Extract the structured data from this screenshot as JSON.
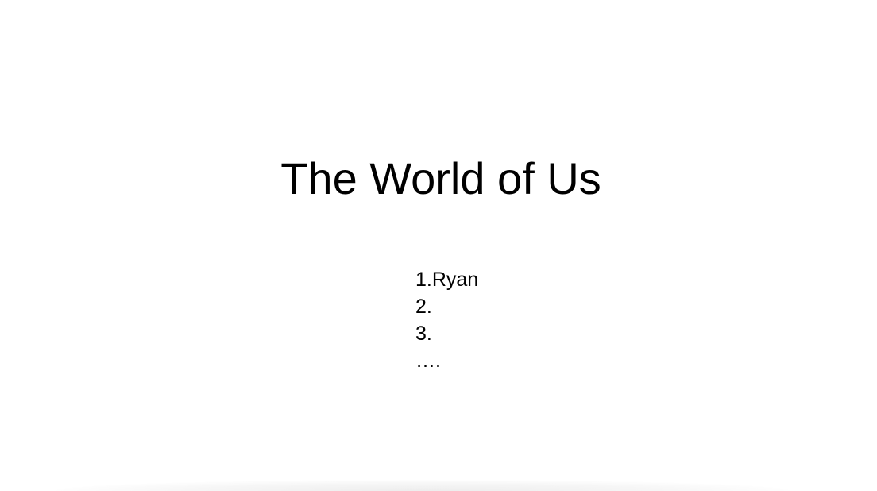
{
  "slide": {
    "title": "The World of Us",
    "list_items": [
      "1.Ryan",
      "2.",
      "3.",
      "…."
    ]
  }
}
